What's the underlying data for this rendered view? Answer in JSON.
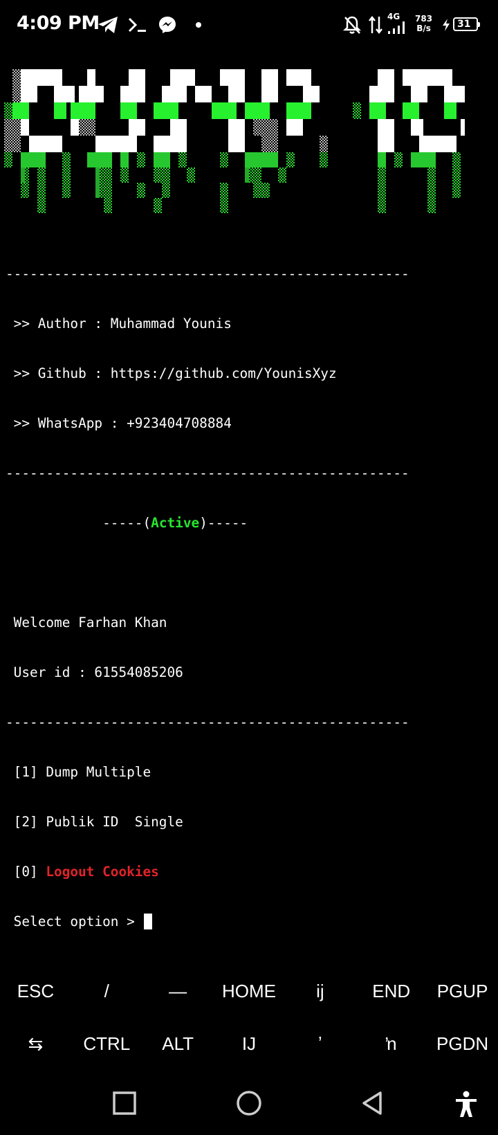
{
  "status_bar": {
    "time": "4:09 PM",
    "network_type": "4G",
    "data_rate_value": "783",
    "data_rate_unit": "B/s",
    "battery": "31"
  },
  "banner": {
    "description_icon": "ascii-art-logo"
  },
  "terminal": {
    "separator": "--------------------------------------------------",
    "author_line": " >> Author : Muhammad Younis",
    "github_line": " >> Github : https://github.com/YounisXyz",
    "whatsapp_line": " >> WhatsApp : +923404708884",
    "active_prefix": "            -----(",
    "active_word": "Active",
    "active_suffix": ")-----",
    "welcome_line": " Welcome Farhan Khan",
    "userid_line": " User id : 61554085206",
    "menu_1": " [1] Dump Multiple",
    "menu_2": " [2] Publik ID  Single",
    "menu_0_prefix": " [0] ",
    "menu_0_text": "Logout Cookies",
    "prompt": " Select option > "
  },
  "extra_keys": {
    "row1": [
      "ESC",
      "/",
      "—",
      "HOME",
      "ij",
      "END",
      "PGUP"
    ],
    "row2": [
      "⇆",
      "CTRL",
      "ALT",
      "IJ",
      "ʼ",
      "ŉ",
      "PGDN"
    ]
  },
  "colors": {
    "green": "#27e52f",
    "red": "#e0242a",
    "background": "#000000"
  }
}
